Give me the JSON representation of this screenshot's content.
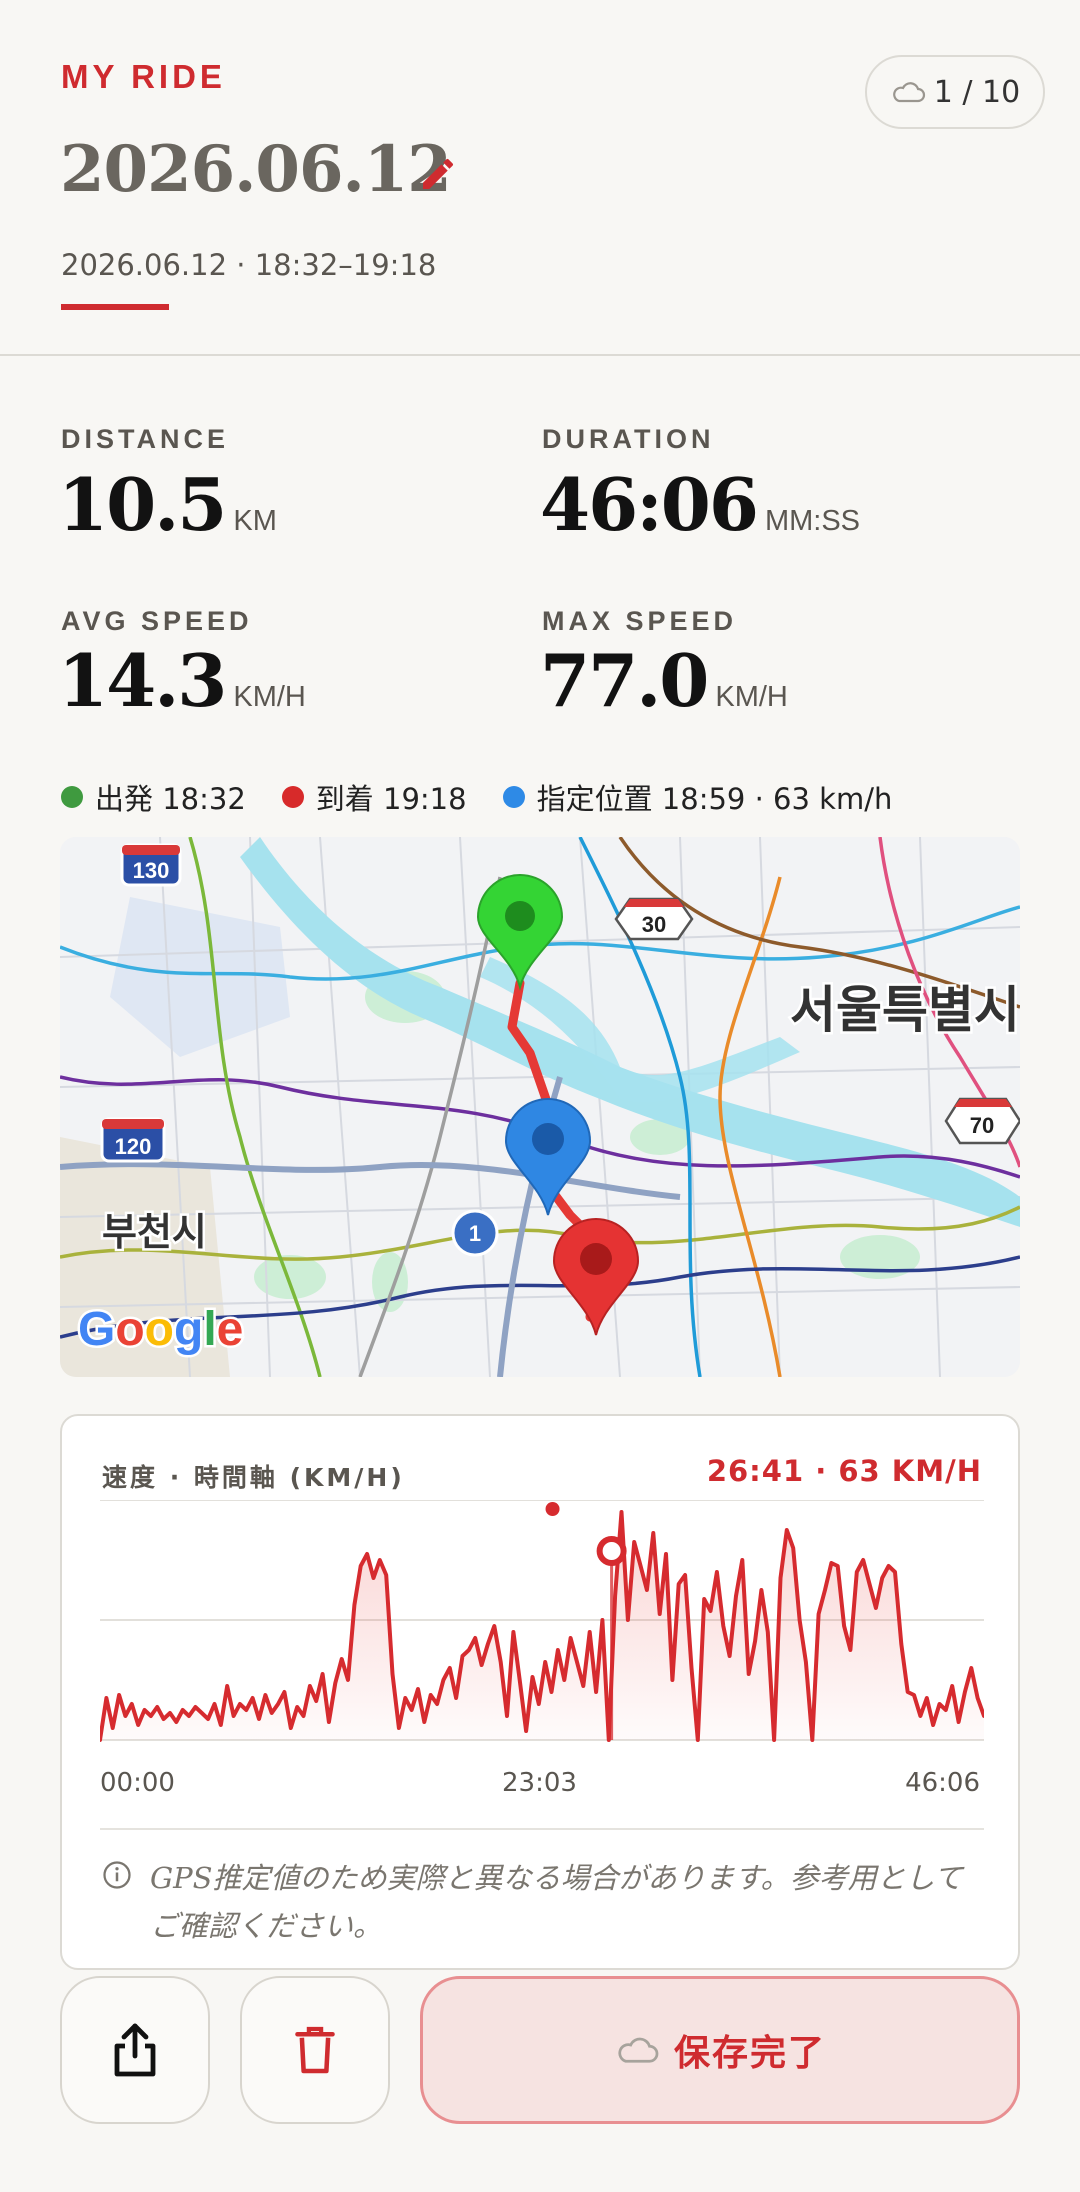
{
  "header": {
    "eyebrow": "MY RIDE",
    "title": "2026.06.12",
    "subtitle": "2026.06.12 · 18:32–19:18",
    "pill_label": "1 / 10"
  },
  "stats": [
    {
      "label": "DISTANCE",
      "value": "10.5",
      "unit": "KM"
    },
    {
      "label": "DURATION",
      "value": "46:06",
      "unit": "MM:SS"
    },
    {
      "label": "AVG SPEED",
      "value": "14.3",
      "unit": "KM/H"
    },
    {
      "label": "MAX SPEED",
      "value": "77.0",
      "unit": "KM/H"
    }
  ],
  "legend": [
    {
      "label": "出発 18:32",
      "color": "#3f9a3f"
    },
    {
      "label": "到着 19:18",
      "color": "#d72a2a"
    },
    {
      "label": "指定位置 18:59 · 63 km/h",
      "color": "#2e8ae6"
    }
  ],
  "map": {
    "city_label_1": "서울특별시",
    "city_label_2": "부천시",
    "shield_130": "130",
    "shield_120": "120",
    "shield_30": "30",
    "shield_70": "70",
    "shield_1": "1",
    "attribution": "Google",
    "route_color": "#e53935",
    "start_pin_color": "#34d434",
    "marker_pin_color": "#2f87e3",
    "end_pin_color": "#e53333"
  },
  "chart": {
    "title": "速度 · 時間軸 (KM/H)",
    "readout": "26:41 · 63 KM/H",
    "ticks": [
      "00:00",
      "23:03",
      "46:06"
    ],
    "note": "GPS推定値のため実際と異なる場合があります。参考用としてご確認ください。"
  },
  "chart_data": {
    "type": "area",
    "xlabel": "",
    "ylabel": "",
    "x_range": [
      0,
      46.1
    ],
    "ylim": [
      0,
      80
    ],
    "grid": true,
    "marker": {
      "x": 26.68,
      "y": 63
    },
    "peak": {
      "x": 23.6,
      "y": 77
    },
    "values": [
      0,
      14,
      4,
      15,
      8,
      12,
      5,
      10,
      8,
      11,
      7,
      9,
      6,
      10,
      8,
      11,
      9,
      7,
      12,
      5,
      18,
      8,
      12,
      10,
      14,
      7,
      15,
      9,
      12,
      16,
      4,
      11,
      8,
      18,
      13,
      22,
      6,
      19,
      27,
      20,
      45,
      58,
      62,
      54,
      60,
      55,
      22,
      4,
      14,
      10,
      17,
      6,
      15,
      12,
      20,
      24,
      14,
      28,
      30,
      34,
      25,
      32,
      38,
      26,
      8,
      36,
      20,
      3,
      21,
      12,
      26,
      16,
      30,
      20,
      34,
      26,
      18,
      36,
      16,
      40,
      0,
      48,
      76,
      40,
      66,
      58,
      50,
      69,
      42,
      62,
      20,
      52,
      55,
      24,
      0,
      47,
      43,
      56,
      38,
      28,
      48,
      60,
      22,
      33,
      50,
      36,
      0,
      54,
      70,
      64,
      40,
      26,
      0,
      42,
      50,
      59,
      58,
      38,
      30,
      56,
      60,
      52,
      44,
      54,
      58,
      56,
      32,
      16,
      15,
      8,
      14,
      5,
      12,
      10,
      18,
      6,
      16,
      24,
      14,
      8
    ]
  },
  "actions": {
    "save_label": "保存完了"
  }
}
